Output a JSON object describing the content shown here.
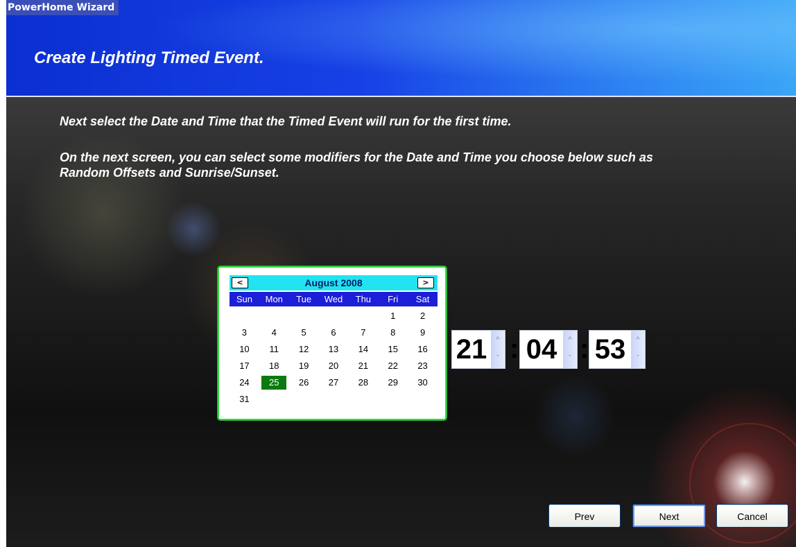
{
  "window": {
    "title": "PowerHome Wizard"
  },
  "header": {
    "title": "Create Lighting Timed Event."
  },
  "intro": {
    "line1": "Next select the Date and Time that the Timed Event will run for the first time.",
    "line2": "On the next screen, you can select some modifiers for the Date and Time you choose below such as Random Offsets and Sunrise/Sunset."
  },
  "calendar": {
    "month_label": "August 2008",
    "prev_label": "<",
    "next_label": ">",
    "days_of_week": [
      "Sun",
      "Mon",
      "Tue",
      "Wed",
      "Thu",
      "Fri",
      "Sat"
    ],
    "weeks": [
      [
        "",
        "",
        "",
        "",
        "",
        "1",
        "2"
      ],
      [
        "3",
        "4",
        "5",
        "6",
        "7",
        "8",
        "9"
      ],
      [
        "10",
        "11",
        "12",
        "13",
        "14",
        "15",
        "16"
      ],
      [
        "17",
        "18",
        "19",
        "20",
        "21",
        "22",
        "23"
      ],
      [
        "24",
        "25",
        "26",
        "27",
        "28",
        "29",
        "30"
      ],
      [
        "31",
        "",
        "",
        "",
        "",
        "",
        ""
      ]
    ],
    "selected_day": "25",
    "colors": {
      "header_bg": "#22e3f0",
      "dow_bg": "#1c1ed8",
      "selected_bg": "#0b7a10",
      "border": "#33dd44"
    }
  },
  "time": {
    "hours": "21",
    "minutes": "04",
    "seconds": "53",
    "separator": ":",
    "spin_up": "^",
    "spin_down": "ˇ"
  },
  "buttons": {
    "prev": "Prev",
    "next": "Next",
    "cancel": "Cancel"
  }
}
